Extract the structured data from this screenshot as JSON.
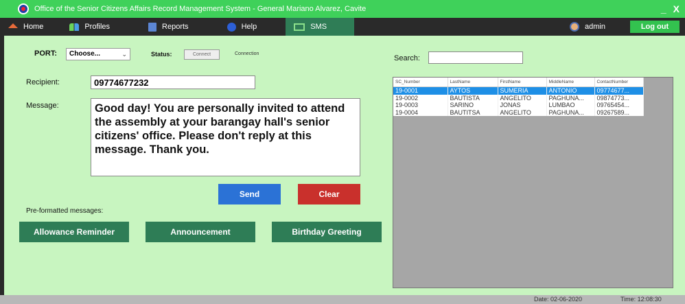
{
  "window": {
    "title": "Office of the Senior Citizens Affairs Record Management System - General Mariano Alvarez, Cavite",
    "minimize": "_",
    "close": "X"
  },
  "menu": {
    "items": [
      {
        "label": "Home",
        "icon": "home-icon"
      },
      {
        "label": "Profiles",
        "icon": "profiles-icon"
      },
      {
        "label": "Reports",
        "icon": "reports-icon"
      },
      {
        "label": "Help",
        "icon": "help-icon"
      },
      {
        "label": "SMS",
        "icon": "sms-icon"
      }
    ],
    "user": "admin",
    "logout": "Log out"
  },
  "sms": {
    "port_label": "PORT:",
    "port_value": "Choose...",
    "status_label": "Status:",
    "status_value": "Connect",
    "connection_label": "Connection",
    "recipient_label": "Recipient:",
    "recipient_value": "09774677232",
    "message_label": "Message:",
    "message_value": "Good day! You are personally invited to attend the assembly at your barangay hall's senior citizens' office. Please don't reply at this message. Thank you.",
    "send": "Send",
    "clear": "Clear",
    "preformatted_label": "Pre-formatted messages:",
    "preformatted": [
      "Allowance Reminder",
      "Announcement",
      "Birthday Greeting"
    ]
  },
  "search": {
    "label": "Search:",
    "value": ""
  },
  "table": {
    "columns": [
      "SC_Number",
      "LastName",
      "FirstName",
      "MiddleName",
      "ContactNumber"
    ],
    "rows": [
      [
        "19-0001",
        "AYTOS",
        "SUMERIA",
        "ANTONIO",
        "09774677..."
      ],
      [
        "19-0002",
        "BAUTISTA",
        "ANGELITO",
        "PAGHUNA...",
        "09874773..."
      ],
      [
        "19-0003",
        "SARINO",
        "JONAS",
        "LUMBAO",
        "09765454..."
      ],
      [
        "19-0004",
        "BAUTITSA",
        "ANGELITO",
        "PAGHUNA...",
        "09267589..."
      ]
    ],
    "selected_row": 0
  },
  "statusbar": {
    "date": "Date: 02-06-2020",
    "time": "Time: 12:08:30"
  },
  "colors": {
    "titlebar": "#3fd15a",
    "menubar": "#2a2a2a",
    "panel": "#c8f5c0",
    "send": "#2b72d6",
    "clear": "#c9302c",
    "preformatted": "#2e7d56",
    "selection": "#1e8fe6"
  }
}
